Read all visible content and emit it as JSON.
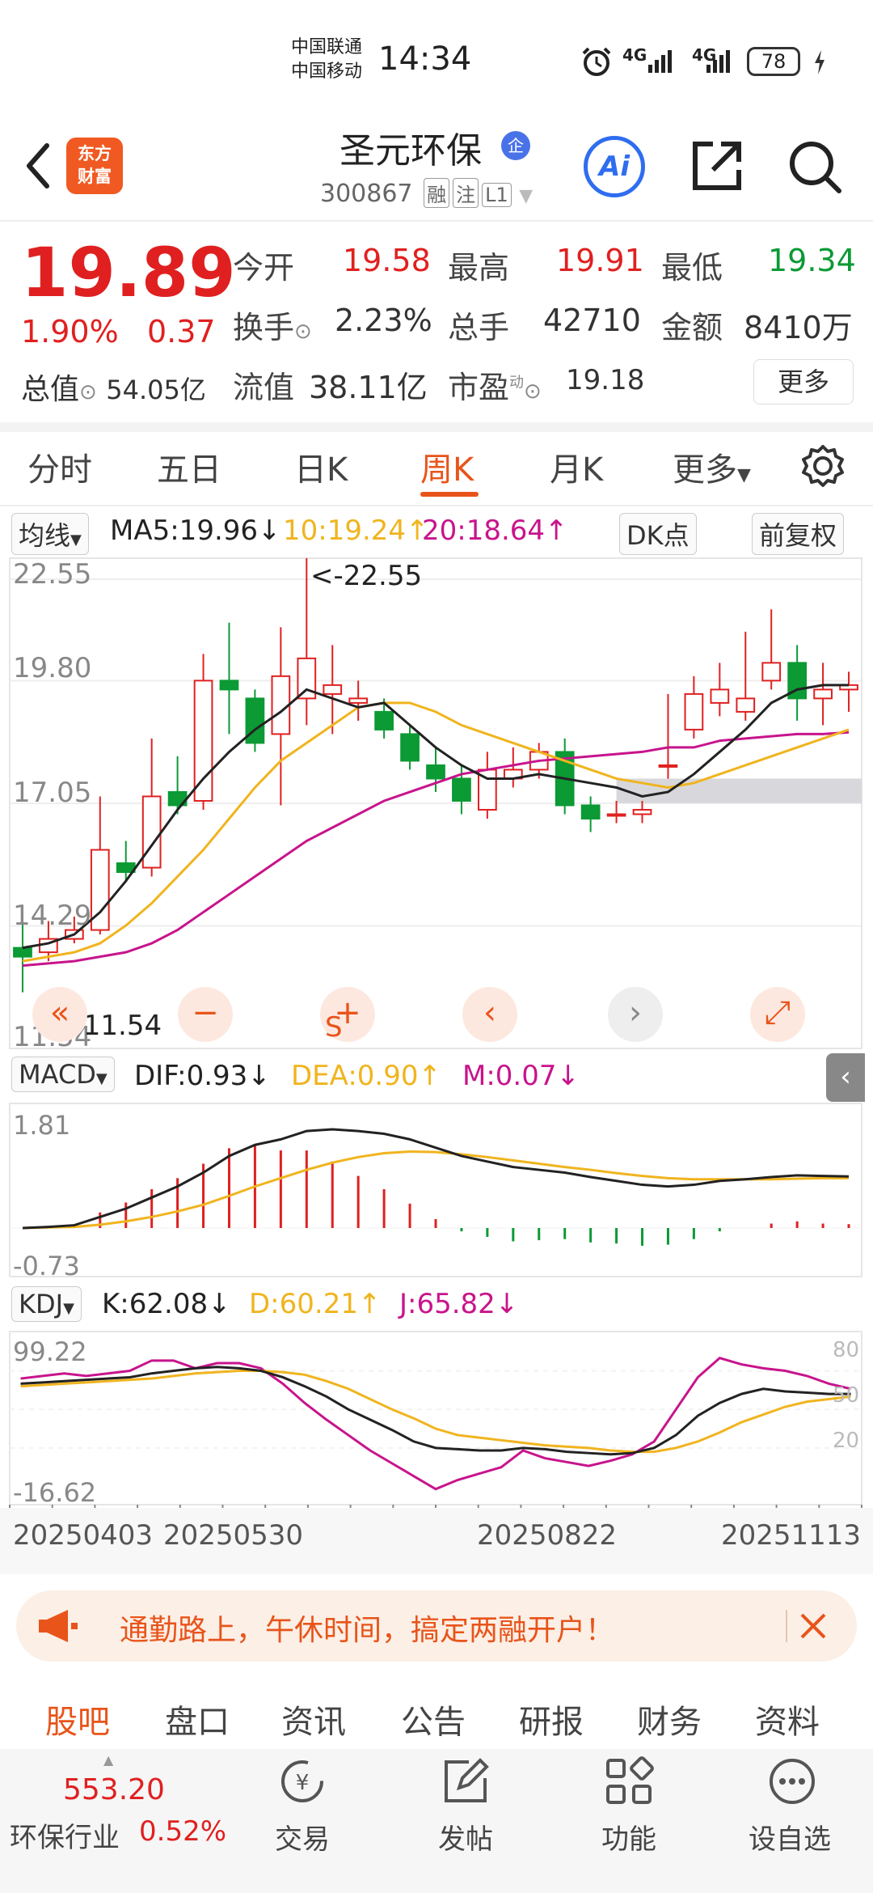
{
  "status_bar": {
    "carrier1": "中国联通",
    "carrier2": "中国移动",
    "time": "14:34",
    "net1": "4G",
    "net2": "4G",
    "battery": "78"
  },
  "header": {
    "logo_line1": "东方",
    "logo_line2": "财富",
    "stock_name": "圣元环保",
    "badge": "企",
    "code": "300867",
    "tags": [
      "融",
      "注",
      "L1"
    ],
    "ai_label": "Ai"
  },
  "quote": {
    "price": "19.89",
    "change_pct": "1.90%",
    "change_abs": "0.37",
    "total_value_label": "总值",
    "total_value": "54.05亿",
    "open_label": "今开",
    "open": "19.58",
    "high_label": "最高",
    "high": "19.91",
    "low_label": "最低",
    "low": "19.34",
    "turnover_label": "换手",
    "turnover": "2.23%",
    "volume_label": "总手",
    "volume": "42710",
    "amount_label": "金额",
    "amount": "8410万",
    "float_label": "流值",
    "float_value": "38.11亿",
    "pe_label": "市盈",
    "pe_sup": "动",
    "pe": "19.18",
    "more": "更多"
  },
  "tabs": {
    "items": [
      "分时",
      "五日",
      "日K",
      "周K",
      "月K",
      "更多"
    ],
    "active": "周K"
  },
  "indicators": {
    "ma_select": "均线",
    "ma5": "MA5:19.96↓",
    "ma10": "10:19.24↑",
    "ma20": "20:18.64↑",
    "dk_button": "DK点",
    "fuquan_button": "前复权",
    "macd_select": "MACD",
    "dif": "DIF:0.93↓",
    "dea": "DEA:0.90↑",
    "m": "M:0.07↓",
    "kdj_select": "KDJ",
    "k": "K:62.08↓",
    "d": "D:60.21↑",
    "j": "J:65.82↓",
    "s_label": "S"
  },
  "colors": {
    "up": "#e02020",
    "down": "#0b9a34",
    "accent": "#e8541a",
    "ma5": "#222222",
    "ma10": "#f0b41e",
    "ma20": "#c8148c"
  },
  "chart_data": [
    {
      "type": "candlestick",
      "title": "",
      "y_ticks": [
        "22.55",
        "19.80",
        "17.05",
        "14.29",
        "11.54"
      ],
      "ylim": [
        11.54,
        22.55
      ],
      "max_label": "<-22.55",
      "min_label": "<-11.54",
      "candles": [
        {
          "o": 13.8,
          "c": 13.6,
          "h": 14.4,
          "l": 12.8
        },
        {
          "o": 13.7,
          "c": 14.0,
          "h": 14.4,
          "l": 13.5
        },
        {
          "o": 14.0,
          "c": 14.2,
          "h": 14.5,
          "l": 13.9
        },
        {
          "o": 14.2,
          "c": 16.0,
          "h": 17.2,
          "l": 14.1
        },
        {
          "o": 15.7,
          "c": 15.5,
          "h": 16.2,
          "l": 15.3
        },
        {
          "o": 15.6,
          "c": 17.2,
          "h": 18.5,
          "l": 15.4
        },
        {
          "o": 17.3,
          "c": 17.0,
          "h": 18.1,
          "l": 16.8
        },
        {
          "o": 17.1,
          "c": 19.8,
          "h": 20.4,
          "l": 16.9
        },
        {
          "o": 19.8,
          "c": 19.6,
          "h": 21.1,
          "l": 18.6
        },
        {
          "o": 19.4,
          "c": 18.4,
          "h": 19.6,
          "l": 18.2
        },
        {
          "o": 18.6,
          "c": 19.9,
          "h": 21.0,
          "l": 17.0
        },
        {
          "o": 19.4,
          "c": 20.3,
          "h": 22.55,
          "l": 18.8
        },
        {
          "o": 19.5,
          "c": 19.7,
          "h": 20.6,
          "l": 18.6
        },
        {
          "o": 19.3,
          "c": 19.4,
          "h": 19.8,
          "l": 18.9
        },
        {
          "o": 19.1,
          "c": 18.7,
          "h": 19.4,
          "l": 18.5
        },
        {
          "o": 18.6,
          "c": 18.0,
          "h": 18.8,
          "l": 17.8
        },
        {
          "o": 17.9,
          "c": 17.6,
          "h": 18.3,
          "l": 17.3
        },
        {
          "o": 17.6,
          "c": 17.1,
          "h": 17.9,
          "l": 16.8
        },
        {
          "o": 16.9,
          "c": 17.8,
          "h": 18.2,
          "l": 16.7
        },
        {
          "o": 17.6,
          "c": 17.8,
          "h": 18.3,
          "l": 17.4
        },
        {
          "o": 17.8,
          "c": 18.2,
          "h": 18.4,
          "l": 17.6
        },
        {
          "o": 18.2,
          "c": 17.0,
          "h": 18.5,
          "l": 16.8
        },
        {
          "o": 17.0,
          "c": 16.7,
          "h": 17.2,
          "l": 16.4
        },
        {
          "o": 16.8,
          "c": 16.8,
          "h": 17.1,
          "l": 16.6
        },
        {
          "o": 16.8,
          "c": 16.9,
          "h": 17.1,
          "l": 16.6
        },
        {
          "o": 17.9,
          "c": 17.9,
          "h": 19.5,
          "l": 17.6
        },
        {
          "o": 18.7,
          "c": 19.5,
          "h": 19.9,
          "l": 18.5
        },
        {
          "o": 19.3,
          "c": 19.6,
          "h": 20.2,
          "l": 19.0
        },
        {
          "o": 19.1,
          "c": 19.4,
          "h": 20.9,
          "l": 18.9
        },
        {
          "o": 19.8,
          "c": 20.2,
          "h": 21.4,
          "l": 19.6
        },
        {
          "o": 20.2,
          "c": 19.4,
          "h": 20.6,
          "l": 18.9
        },
        {
          "o": 19.4,
          "c": 19.6,
          "h": 20.2,
          "l": 18.8
        },
        {
          "o": 19.6,
          "c": 19.7,
          "h": 20.0,
          "l": 19.1
        }
      ],
      "ma5": [
        13.8,
        13.9,
        14.1,
        14.6,
        15.3,
        16.1,
        16.9,
        17.6,
        18.2,
        18.7,
        19.1,
        19.6,
        19.4,
        19.2,
        19.3,
        18.8,
        18.3,
        17.9,
        17.6,
        17.6,
        17.7,
        17.6,
        17.5,
        17.4,
        17.2,
        17.3,
        17.7,
        18.2,
        18.7,
        19.3,
        19.6,
        19.7,
        19.7
      ],
      "ma10": [
        13.5,
        13.6,
        13.7,
        13.9,
        14.3,
        14.8,
        15.4,
        16.0,
        16.7,
        17.4,
        18.0,
        18.4,
        18.8,
        19.2,
        19.3,
        19.3,
        19.1,
        18.8,
        18.6,
        18.4,
        18.2,
        18.0,
        17.8,
        17.6,
        17.5,
        17.4,
        17.5,
        17.7,
        17.9,
        18.1,
        18.3,
        18.5,
        18.7
      ],
      "ma20": [
        13.4,
        13.45,
        13.5,
        13.6,
        13.7,
        13.9,
        14.2,
        14.6,
        15.0,
        15.4,
        15.8,
        16.2,
        16.5,
        16.8,
        17.1,
        17.3,
        17.5,
        17.7,
        17.8,
        17.9,
        18.0,
        18.05,
        18.1,
        18.15,
        18.2,
        18.3,
        18.3,
        18.45,
        18.5,
        18.55,
        18.6,
        18.6,
        18.64
      ],
      "dk_band": [
        17.05,
        17.6
      ]
    },
    {
      "type": "macd",
      "y_ticks": [
        "1.81",
        "-0.73"
      ],
      "ylim": [
        -0.73,
        1.81
      ],
      "dif": [
        0.0,
        0.02,
        0.05,
        0.2,
        0.35,
        0.55,
        0.75,
        1.0,
        1.3,
        1.5,
        1.6,
        1.75,
        1.78,
        1.75,
        1.7,
        1.6,
        1.45,
        1.3,
        1.2,
        1.1,
        1.05,
        1.0,
        0.92,
        0.85,
        0.78,
        0.75,
        0.78,
        0.85,
        0.88,
        0.92,
        0.95,
        0.94,
        0.93
      ],
      "dea": [
        0.0,
        0.01,
        0.02,
        0.06,
        0.12,
        0.2,
        0.3,
        0.42,
        0.58,
        0.75,
        0.9,
        1.05,
        1.18,
        1.28,
        1.35,
        1.38,
        1.37,
        1.33,
        1.28,
        1.22,
        1.16,
        1.1,
        1.05,
        0.99,
        0.94,
        0.9,
        0.88,
        0.88,
        0.88,
        0.88,
        0.89,
        0.9,
        0.9
      ],
      "m": [
        0.0,
        0.02,
        0.06,
        0.28,
        0.46,
        0.7,
        0.9,
        1.16,
        1.44,
        1.5,
        1.4,
        1.4,
        1.2,
        0.94,
        0.7,
        0.44,
        0.16,
        -0.06,
        -0.16,
        -0.24,
        -0.22,
        -0.2,
        -0.26,
        -0.28,
        -0.32,
        -0.3,
        -0.2,
        -0.06,
        0.0,
        0.08,
        0.12,
        0.08,
        0.07
      ]
    },
    {
      "type": "kdj",
      "y_ticks": [
        "99.22",
        "-16.62"
      ],
      "right_ticks": [
        "80",
        "50",
        "20"
      ],
      "ylim": [
        -16.62,
        99.22
      ],
      "k": [
        70,
        71,
        72,
        73,
        74,
        75,
        78,
        80,
        82,
        83,
        82,
        80,
        75,
        68,
        60,
        50,
        42,
        34,
        25,
        20,
        19,
        18,
        18,
        20,
        19,
        17,
        16,
        15,
        16,
        20,
        30,
        45,
        55,
        62,
        66,
        64,
        63,
        62,
        62
      ],
      "d": [
        68,
        69,
        70,
        71,
        72,
        73,
        74,
        76,
        78,
        79,
        80,
        80,
        79,
        77,
        72,
        66,
        58,
        50,
        43,
        35,
        30,
        28,
        26,
        24,
        22,
        21,
        20,
        18,
        17,
        17,
        20,
        25,
        32,
        40,
        46,
        52,
        56,
        58,
        60
      ],
      "j": [
        74,
        76,
        78,
        76,
        78,
        80,
        88,
        88,
        82,
        86,
        86,
        82,
        70,
        55,
        42,
        30,
        18,
        8,
        -2,
        -12,
        -5,
        0,
        5,
        18,
        12,
        9,
        6,
        10,
        15,
        25,
        50,
        75,
        90,
        85,
        82,
        80,
        76,
        70,
        66
      ],
      "dates": [
        "20250403",
        "20250530",
        "20250822",
        "20251113"
      ]
    }
  ],
  "banner": {
    "text": "通勤路上，午休时间，搞定两融开户！"
  },
  "bottom_tabs": {
    "items": [
      "股吧",
      "盘口",
      "资讯",
      "公告",
      "研报",
      "财务",
      "资料"
    ],
    "active": "股吧"
  },
  "bottom_bar": {
    "index_value": "553.20",
    "industry": "环保行业",
    "industry_pct": "0.52%",
    "trade": "交易",
    "post": "发帖",
    "functions": "功能",
    "watchlist": "设自选"
  }
}
